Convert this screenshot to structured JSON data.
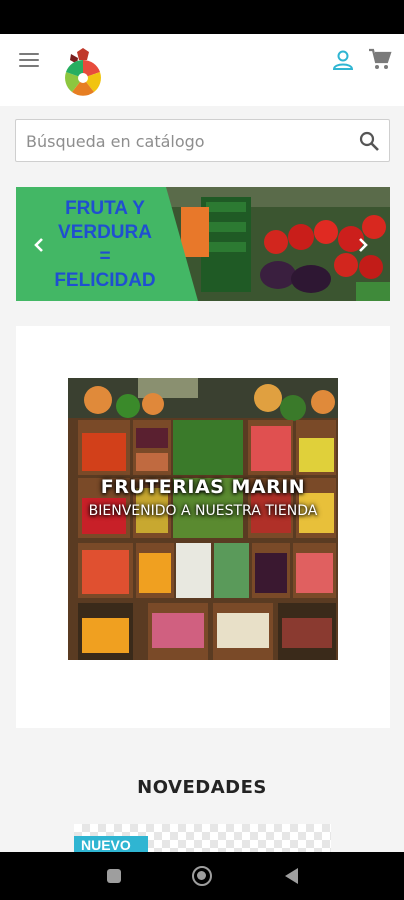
{
  "header": {
    "menu_icon": "hamburger-menu-icon",
    "logo_icon": "fruit-basket-logo",
    "user_icon": "user-account-icon",
    "cart_icon": "shopping-cart-icon",
    "accent_color": "#2fb5d2"
  },
  "search": {
    "value": "",
    "placeholder": "Búsqueda en catálogo",
    "icon": "magnifier-search-icon"
  },
  "carousel": {
    "lines": [
      "FRUTA Y",
      "VERDURA",
      "=",
      "FELICIDAD"
    ],
    "text_color": "#1f4fd1",
    "panel_color": "#43b765",
    "prev_icon": "chevron-left-icon",
    "next_icon": "chevron-right-icon"
  },
  "promo": {
    "title": "FRUTERIAS MARIN",
    "subtitle": "BIENVENIDO A NUESTRA TIENDA"
  },
  "section": {
    "title": "NOVEDADES"
  },
  "product": {
    "badge": "NUEVO",
    "badge_color": "#2fb5d2"
  },
  "navigation": {
    "recents_icon": "square-recents-icon",
    "home_icon": "circle-home-icon",
    "back_icon": "triangle-back-icon"
  }
}
